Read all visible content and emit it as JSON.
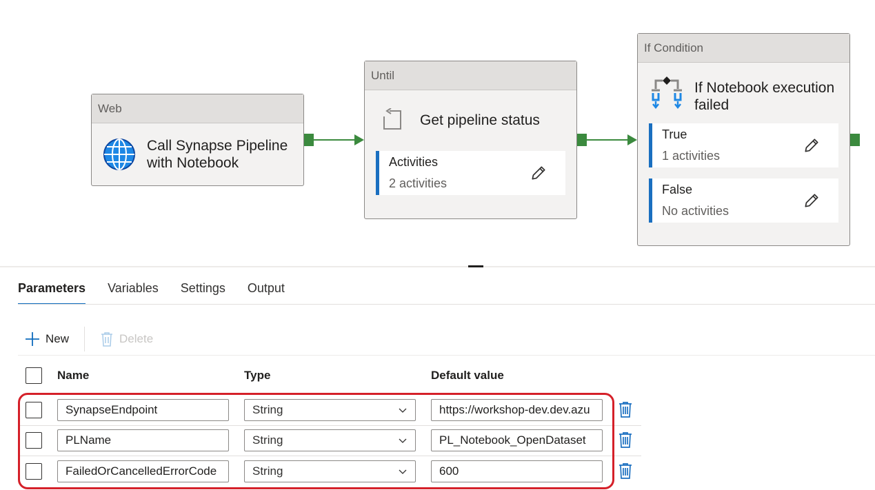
{
  "pipeline": {
    "web": {
      "type": "Web",
      "title_line1": "Call Synapse Pipeline",
      "title_line2": "with Notebook",
      "icon": "globe-icon"
    },
    "until": {
      "type": "Until",
      "title": "Get pipeline status",
      "icon": "loop-icon",
      "sub": {
        "title": "Activities",
        "count": "2 activities"
      }
    },
    "if": {
      "type": "If Condition",
      "title_line1": "If Notebook execution",
      "title_line2": "failed",
      "icon": "branch-icon",
      "true": {
        "title": "True",
        "count": "1 activities"
      },
      "false": {
        "title": "False",
        "count": "No activities"
      }
    }
  },
  "tabs": [
    {
      "label": "Parameters",
      "active": true
    },
    {
      "label": "Variables",
      "active": false
    },
    {
      "label": "Settings",
      "active": false
    },
    {
      "label": "Output",
      "active": false
    }
  ],
  "toolbar": {
    "new_label": "New",
    "delete_label": "Delete"
  },
  "table": {
    "headers": {
      "name": "Name",
      "type": "Type",
      "default": "Default value"
    },
    "rows": [
      {
        "name": "SynapseEndpoint",
        "type": "String",
        "default": "https://workshop-dev.dev.azu"
      },
      {
        "name": "PLName",
        "type": "String",
        "default": "PL_Notebook_OpenDataset"
      },
      {
        "name": "FailedOrCancelledErrorCode",
        "type": "String",
        "default": "600"
      }
    ]
  },
  "colors": {
    "accent": "#0f6cbd",
    "link": "#3b8a3e",
    "sub_bar": "#1a6fc0",
    "highlight": "#d52029"
  }
}
